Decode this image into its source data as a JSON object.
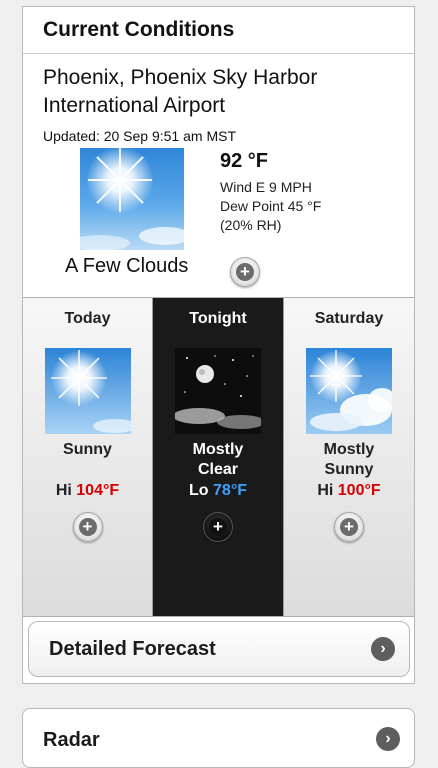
{
  "current": {
    "header": "Current Conditions",
    "location_line1": "Phoenix, Phoenix Sky Harbor",
    "location_line2": "International Airport",
    "updated": "Updated: 20 Sep 9:51 am MST",
    "temperature": "92 °F",
    "wind": "Wind E 9 MPH",
    "dew_point": "Dew Point 45 °F",
    "humidity": "(20% RH)",
    "condition": "A Few Clouds",
    "icon": "sunny-sky-icon"
  },
  "forecast": [
    {
      "day": "Today",
      "condition_line1": "Sunny",
      "condition_line2": "",
      "temp_prefix": "Hi",
      "temp_value": "104°F",
      "icon": "sunny-icon"
    },
    {
      "day": "Tonight",
      "condition_line1": "Mostly",
      "condition_line2": "Clear",
      "temp_prefix": "Lo",
      "temp_value": "78°F",
      "icon": "moon-clear-icon"
    },
    {
      "day": "Saturday",
      "condition_line1": "Mostly",
      "condition_line2": "Sunny",
      "temp_prefix": "Hi",
      "temp_value": "100°F",
      "icon": "mostly-sunny-icon"
    }
  ],
  "detailed_forecast_label": "Detailed Forecast",
  "radar_label": "Radar",
  "colors": {
    "hi": "#d80000",
    "lo": "#3aa0ff"
  }
}
